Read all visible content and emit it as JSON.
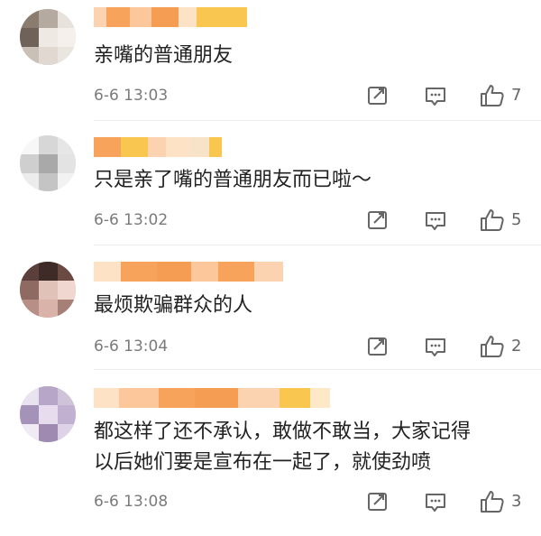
{
  "comments": [
    {
      "text": "亲嘴的普通朋友",
      "time": "6-6 13:03",
      "likes": "7"
    },
    {
      "text": "只是亲了嘴的普通朋友而已啦～",
      "time": "6-6 13:02",
      "likes": "5"
    },
    {
      "text": "最烦欺骗群众的人",
      "time": "6-6 13:04",
      "likes": "2"
    },
    {
      "text_line1": "都这样了还不承认，敢做不敢当，大家记得",
      "text_line2": "以后她们要是宣布在一起了，就使劲喷",
      "time": "6-6 13:08",
      "likes": "3"
    }
  ],
  "icons": {
    "repost": "repost-icon",
    "comment": "comment-icon",
    "like": "thumbs-up-icon"
  },
  "colors": {
    "mosaic_orange": "#f7a35c",
    "mosaic_yellow": "#f9c74f",
    "text": "#222222",
    "meta": "#7a7a7a"
  }
}
